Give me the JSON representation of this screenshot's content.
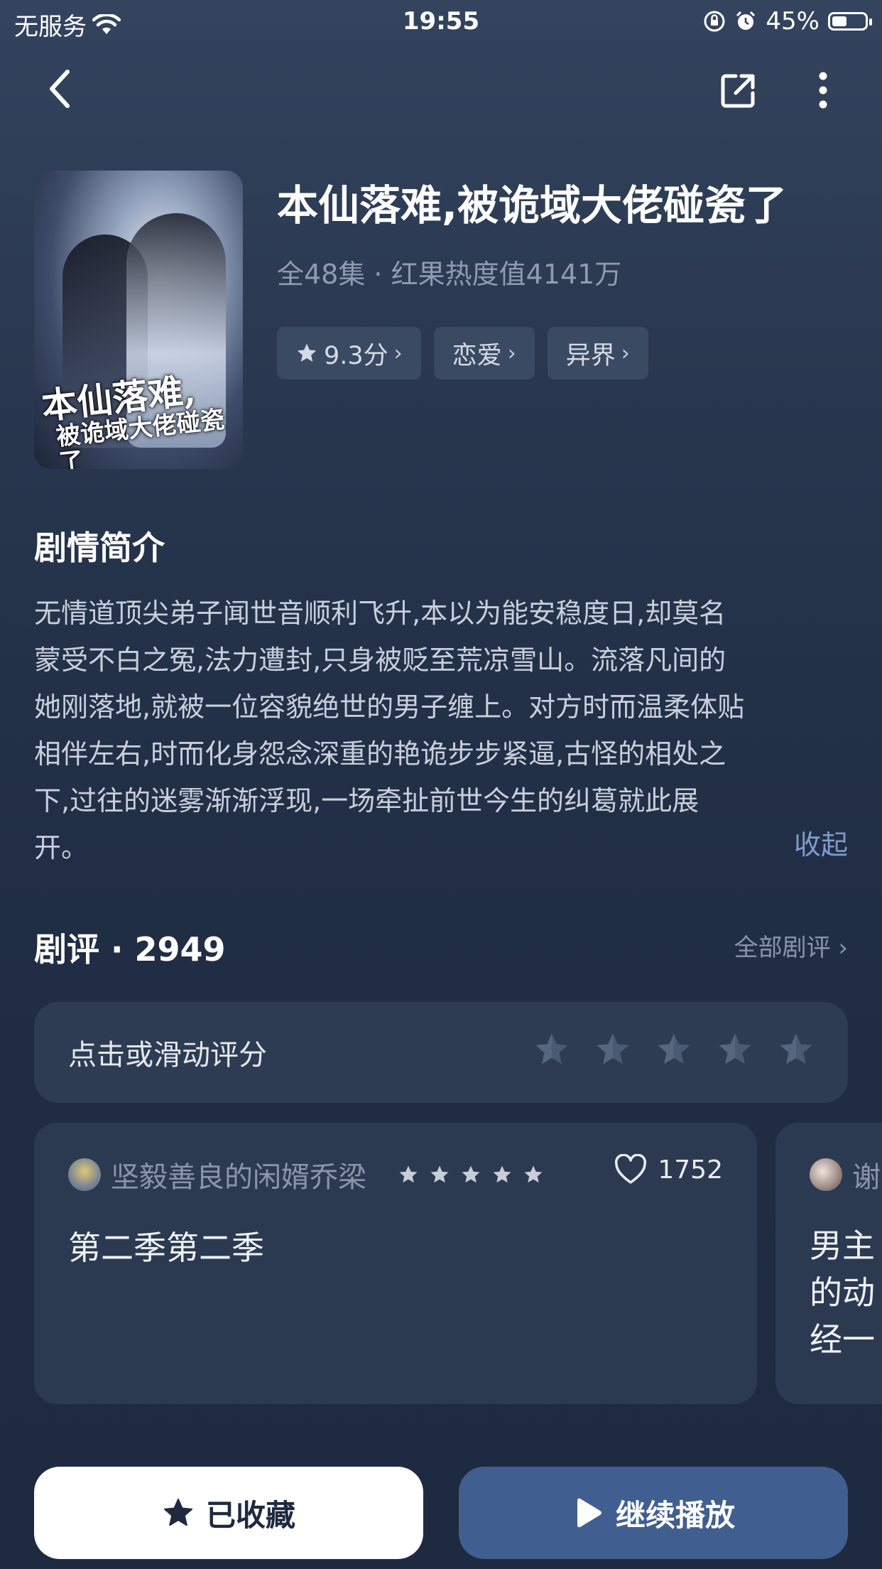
{
  "status_bar": {
    "carrier": "无服务",
    "time": "19:55",
    "battery": "45%",
    "battery_level": 0.45
  },
  "nav": {
    "icons": [
      "back-icon",
      "share-icon",
      "more-icon"
    ]
  },
  "drama": {
    "cover_text_line1": "本仙落难,",
    "cover_text_line2": "被诡域大佬碰瓷了",
    "title": "本仙落难,被诡域大佬碰瓷了",
    "meta": "全48集 · 红果热度值4141万",
    "tags": [
      {
        "label": "9.3分",
        "icon": "star-icon"
      },
      {
        "label": "恋爱"
      },
      {
        "label": "异界"
      }
    ]
  },
  "synopsis": {
    "title": "剧情简介",
    "lines": [
      "无情道顶尖弟子闻世音顺利飞升,本以为能安稳度日,却莫名",
      "蒙受不白之冤,法力遭封,只身被贬至荒凉雪山。流落凡间的",
      "她刚落地,就被一位容貌绝世的男子缠上。对方时而温柔体贴",
      "相伴左右,时而化身怨念深重的艳诡步步紧逼,古怪的相处之",
      "下,过往的迷雾渐渐浮现,一场牵扯前世今生的纠葛就此展",
      "开。"
    ],
    "collapse_label": "收起"
  },
  "reviews": {
    "title": "剧评 · 2949",
    "all_label": "全部剧评",
    "rate_prompt": "点击或滑动评分",
    "user_rating": 0,
    "items": [
      {
        "user": "坚毅善良的闲婿乔梁",
        "stars": 5,
        "likes": "1752",
        "text": "第二季第二季"
      },
      {
        "user": "谢",
        "text_lines": [
          "男主",
          "的动",
          "经一"
        ]
      }
    ]
  },
  "actions": {
    "favorite_label": "已收藏",
    "play_label": "继续播放"
  },
  "colors": {
    "accent": "#405e90",
    "link": "#7f9ccc",
    "tag_bg": "#3a4a62",
    "card_bg": "#2c3a51"
  }
}
